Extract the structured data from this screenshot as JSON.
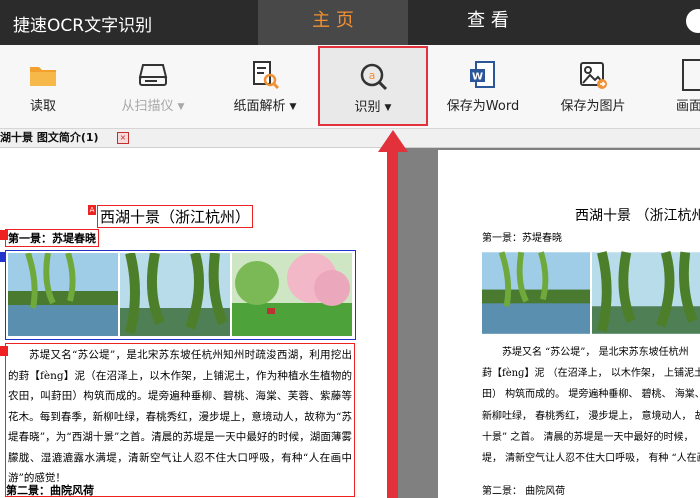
{
  "app": {
    "title": "捷速OCR文字识别"
  },
  "tabs": [
    {
      "label": "主 页"
    },
    {
      "label": "查 看"
    }
  ],
  "ribbon": {
    "read": "读取",
    "scanner": "从扫描仪",
    "layout": "纸面解析",
    "recognize": "识别",
    "save_word": "保存为Word",
    "save_image": "保存为图片",
    "partial": "画面"
  },
  "doc_tab": {
    "label": "湖十景 图文简介(1)"
  },
  "left_doc": {
    "title": "西湖十景（浙江杭州）",
    "section1": "第一景：苏堤春晓",
    "paragraph": "苏堤又名“苏公堤”，是北宋苏东坡任杭州知州时疏浚西湖，利用挖出的葑【fèng】泥（在沼泽上，以木作架，上铺泥土，作为种植水生植物的农田，叫葑田）构筑而成的。堤旁遍种垂柳、碧桃、海棠、芙蓉、紫藤等花木。每到春季，新柳吐绿，春桃秀红，漫步堤上，意境动人，故称为“苏堤春晓”，为“西湖十景”之首。清晨的苏堤是一天中最好的时候，湖面薄雾朦胧、湿漉漉露水满堤，清新空气让人忍不住大口呼吸，有种“人在画中游”的感觉！",
    "section2": "第二景：曲院风荷"
  },
  "right_doc": {
    "title": "西湖十景 （浙江杭州）",
    "section1": "第一景：苏堤春晓",
    "lines": [
      "苏堤又名 “苏公堤”， 是北宋苏东坡任杭州",
      "葑【fènɡ】泥 （在沼泽上， 以木作架， 上铺泥土",
      "田） 构筑而成的。 堤旁遍种垂柳、 碧桃、 海棠、 芙",
      "新柳吐绿， 春桃秀红， 漫步堤上， 意境动人， 故称",
      "十景” 之首。 清晨的苏堤是一天中最好的时候，",
      "堤， 清新空气让人忍不住大口呼吸， 有种 “人在画"
    ],
    "section2": "第二景：   曲院风荷"
  },
  "colors": {
    "accent": "#f29133",
    "highlight": "#e3313c",
    "topbar": "#2b2b2b"
  },
  "icons": [
    "folder-icon",
    "scanner-icon",
    "layout-analysis-icon",
    "recognize-icon",
    "word-icon",
    "image-icon"
  ]
}
